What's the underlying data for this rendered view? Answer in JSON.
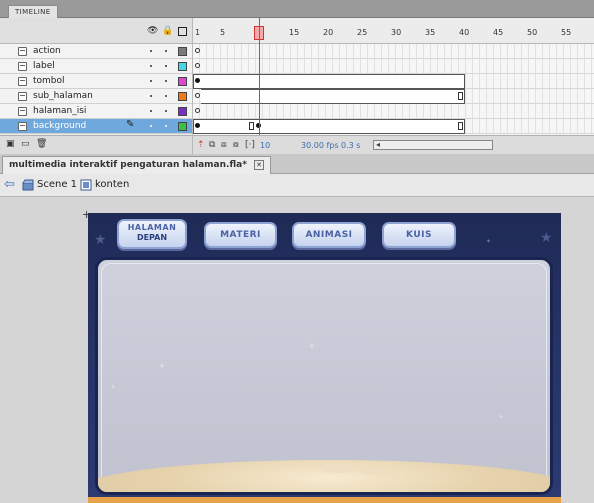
{
  "timeline": {
    "tab_label": "TIMELINE",
    "layers": [
      {
        "name": "action",
        "color": "#7a7a7a",
        "selected": false
      },
      {
        "name": "label",
        "color": "#41d6e8",
        "selected": false
      },
      {
        "name": "tombol",
        "color": "#e046d0",
        "selected": false
      },
      {
        "name": "sub_halaman",
        "color": "#f07a1a",
        "selected": false
      },
      {
        "name": "halaman_isi",
        "color": "#7a2fc6",
        "selected": false
      },
      {
        "name": "background",
        "color": "#39c04a",
        "selected": true
      }
    ],
    "ruler_numbers": [
      "1",
      "5",
      "10",
      "15",
      "20",
      "25",
      "30",
      "35",
      "40",
      "45",
      "50",
      "55"
    ],
    "status": {
      "current_frame": "10",
      "fps": "30.00 fps",
      "elapsed": "0.3 s"
    }
  },
  "document": {
    "tab_title": "multimedia interaktif pengaturan halaman.fla*",
    "close_glyph": "✕"
  },
  "breadcrumb": {
    "scene": "Scene 1",
    "symbol": "konten"
  },
  "stage": {
    "buttons": [
      {
        "line1": "HALAMAN",
        "line2": "DEPAN"
      },
      {
        "line1": "MATERI"
      },
      {
        "line1": "ANIMASI"
      },
      {
        "line1": "KUIS"
      }
    ],
    "colors": {
      "background": "#243063",
      "button_fill": "#dbe4f7",
      "button_text": "#4b62a4",
      "panel": "#c9cbd8",
      "moon": "#e8d5ae"
    }
  },
  "icons": {
    "eye": "eye-icon",
    "lock": "lock-icon",
    "outline": "outline-icon",
    "layer": "layer-icon",
    "pencil": "pencil-icon",
    "back": "back-arrow-icon",
    "scene": "scene-icon",
    "symbol": "symbol-icon"
  }
}
